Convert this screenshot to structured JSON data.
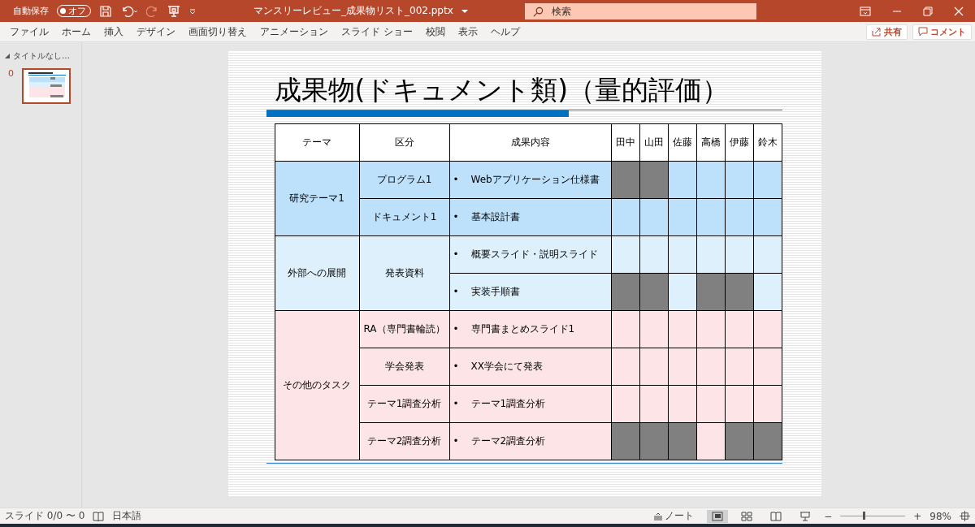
{
  "titlebar": {
    "autosave_label": "自動保存",
    "autosave_toggle": "オフ",
    "autosave_on": false,
    "filename": "マンスリーレビュー_成果物リスト_002.pptx",
    "search_placeholder": "検索"
  },
  "ribbon": {
    "tabs": [
      "ファイル",
      "ホーム",
      "挿入",
      "デザイン",
      "画面切り替え",
      "アニメーション",
      "スライド ショー",
      "校閲",
      "表示",
      "ヘルプ"
    ],
    "share": "共有",
    "comment": "コメント"
  },
  "thumbnails": {
    "section": "タイトルなし…",
    "slide_number": "0"
  },
  "slide": {
    "title": "成果物(ドキュメント類)（量的評価）",
    "headers": [
      "テーマ",
      "区分",
      "成果内容"
    ],
    "people": [
      "田中",
      "山田",
      "佐藤",
      "高橋",
      "伊藤",
      "鈴木"
    ],
    "bullet": "•",
    "groups": [
      {
        "theme": "研究テーマ1",
        "color": "#bde0fb",
        "categories": [
          {
            "label": "プログラム1",
            "items": [
              {
                "text": "Webアプリケーション仕様書",
                "marks": [
                  true,
                  true,
                  false,
                  false,
                  false,
                  false
                ]
              }
            ]
          },
          {
            "label": "ドキュメント1",
            "items": [
              {
                "text": "基本設計書",
                "marks": [
                  false,
                  false,
                  false,
                  false,
                  false,
                  false
                ]
              }
            ]
          }
        ]
      },
      {
        "theme": "外部への展開",
        "color": "#def0fc",
        "categories": [
          {
            "label": "発表資料",
            "items": [
              {
                "text": "概要スライド・説明スライド",
                "marks": [
                  false,
                  false,
                  false,
                  false,
                  false,
                  false
                ]
              },
              {
                "text": "実装手順書",
                "marks": [
                  true,
                  true,
                  false,
                  true,
                  true,
                  false
                ]
              }
            ]
          }
        ]
      },
      {
        "theme": "その他のタスク",
        "color": "#fde4e6",
        "categories": [
          {
            "label": "RA（専門書輪読）",
            "items": [
              {
                "text": "専門書まとめスライド1",
                "marks": [
                  false,
                  false,
                  false,
                  false,
                  false,
                  false
                ]
              }
            ]
          },
          {
            "label": "学会発表",
            "items": [
              {
                "text": "XX学会にて発表",
                "marks": [
                  false,
                  false,
                  false,
                  false,
                  false,
                  false
                ]
              }
            ]
          },
          {
            "label": "テーマ1調査分析",
            "items": [
              {
                "text": "テーマ1調査分析",
                "marks": [
                  false,
                  false,
                  false,
                  false,
                  false,
                  false
                ]
              }
            ]
          },
          {
            "label": "テーマ2調査分析",
            "items": [
              {
                "text": "テーマ2調査分析",
                "marks": [
                  true,
                  true,
                  true,
                  false,
                  true,
                  true
                ]
              }
            ]
          }
        ]
      }
    ]
  },
  "status_bar": {
    "slide_info": "スライド 0/0 〜 0",
    "language": "日本語",
    "notes": "ノート",
    "zoom_out": "−",
    "zoom_in": "+",
    "zoom": {
      "level": 0.35
    },
    "zoom_reading": "98%"
  }
}
